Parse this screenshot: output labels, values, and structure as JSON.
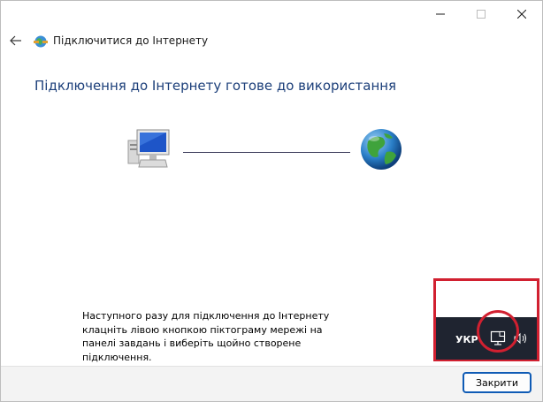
{
  "window": {
    "title": "Підключитися до Інтернету",
    "controls": {
      "minimize_icon": "minimize-icon",
      "maximize_icon": "maximize-icon",
      "close_icon": "close-icon"
    }
  },
  "content": {
    "heading": "Підключення до Інтернету готове до використання",
    "info_text": "Наступного разу для підключення до Інтернету клацніть лівою кнопкою піктограму мережі на панелі завдань і виберіть щойно створене підключення."
  },
  "taskbar": {
    "language": "УКР",
    "icons": [
      "network-icon",
      "speaker-icon"
    ]
  },
  "footer": {
    "close_button": "Закрити"
  },
  "colors": {
    "heading": "#1c3f7a",
    "highlight": "#d12030",
    "taskbar_bg": "#1f2430",
    "button_border": "#0f5bb5"
  }
}
